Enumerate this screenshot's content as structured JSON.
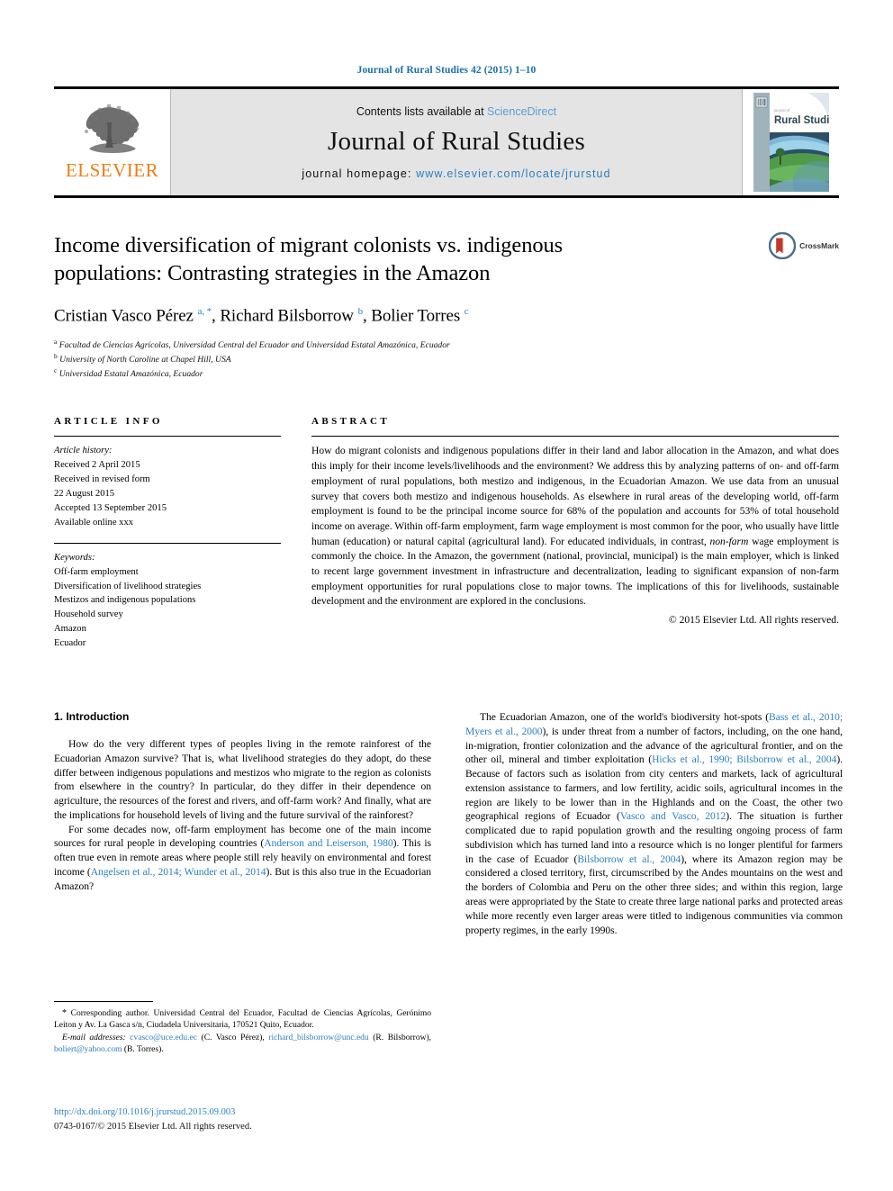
{
  "running_head": "Journal of Rural Studies 42 (2015) 1–10",
  "masthead": {
    "publisher_name": "ELSEVIER",
    "contents_prefix": "Contents lists available at",
    "contents_link": "ScienceDirect",
    "journal_name": "Journal of Rural Studies",
    "homepage_prefix": "journal homepage:",
    "homepage_url": "www.elsevier.com/locate/jrurstud",
    "cover_title": "Rural Studies",
    "cover_supertitle": "journal of"
  },
  "article": {
    "title": "Income diversification of migrant colonists vs. indigenous populations: Contrasting strategies in the Amazon",
    "authors_html": "Cristian Vasco Pérez <sup>a, *</sup>, Richard Bilsborrow <sup>b</sup>, Bolier Torres <sup>c</sup>",
    "affiliations": [
      {
        "marker": "a",
        "text": "Facultad de Ciencias Agrícolas, Universidad Central del Ecuador and Universidad Estatal Amazónica, Ecuador"
      },
      {
        "marker": "b",
        "text": "University of North Caroline at Chapel Hill, USA"
      },
      {
        "marker": "c",
        "text": "Universidad Estatal Amazónica, Ecuador"
      }
    ],
    "crossmark_label": "CrossMark"
  },
  "article_info": {
    "heading": "ARTICLE INFO",
    "history_label": "Article history:",
    "history": [
      "Received 2 April 2015",
      "Received in revised form",
      "22 August 2015",
      "Accepted 13 September 2015",
      "Available online xxx"
    ],
    "keywords_label": "Keywords:",
    "keywords": [
      "Off-farm employment",
      "Diversification of livelihood strategies",
      "Mestizos and indigenous populations",
      "Household survey",
      "Amazon",
      "Ecuador"
    ]
  },
  "abstract": {
    "heading": "ABSTRACT",
    "text_html": "How do migrant colonists and indigenous populations differ in their land and labor allocation in the Amazon, and what does this imply for their income levels/livelihoods and the environment? We address this by analyzing patterns of on- and off-farm employment of rural populations, both mestizo and indigenous, in the Ecuadorian Amazon. We use data from an unusual survey that covers both mestizo and indigenous households. As elsewhere in rural areas of the developing world, off-farm employment is found to be the principal income source for 68% of the population and accounts for 53% of total household income on average. Within off-farm employment, farm wage employment is most common for the poor, who usually have little human (education) or natural capital (agricultural land). For educated individuals, in contrast, <em>non-farm</em> wage employment is commonly the choice. In the Amazon, the government (national, provincial, municipal) is the main employer, which is linked to recent large government investment in infrastructure and decentralization, leading to significant expansion of non-farm employment opportunities for rural populations close to major towns. The implications of this for livelihoods, sustainable development and the environment are explored in the conclusions.",
    "copyright": "© 2015 Elsevier Ltd. All rights reserved."
  },
  "introduction": {
    "heading": "1. Introduction",
    "left_paragraphs_html": [
      "How do the very different types of peoples living in the remote rainforest of the Ecuadorian Amazon survive? That is, what livelihood strategies do they adopt, do these differ between indigenous populations and mestizos who migrate to the region as colonists from elsewhere in the country? In particular, do they differ in their dependence on agriculture, the resources of the forest and rivers, and off-farm work? And finally, what are the implications for household levels of living and the future survival of the rainforest?",
      "For some decades now, off-farm employment has become one of the main income sources for rural people in developing countries (<span class=\"ref\">Anderson and Leiserson, 1980</span>). This is often true even in remote areas where people still rely heavily on environmental and forest income (<span class=\"ref\">Angelsen et al., 2014; Wunder et al., 2014</span>). But is this also true in the Ecuadorian Amazon?"
    ],
    "right_paragraphs_html": [
      "The Ecuadorian Amazon, one of the world's biodiversity hot-spots (<span class=\"ref\">Bass et al., 2010; Myers et al., 2000</span>), is under threat from a number of factors, including, on the one hand, in-migration, frontier colonization and the advance of the agricultural frontier, and on the other oil, mineral and timber exploitation (<span class=\"ref\">Hicks et al., 1990; Bilsborrow et al., 2004</span>). Because of factors such as isolation from city centers and markets, lack of agricultural extension assistance to farmers, and low fertility, acidic soils, agricultural incomes in the region are likely to be lower than in the Highlands and on the Coast, the other two geographical regions of Ecuador (<span class=\"ref\">Vasco and Vasco, 2012</span>). The situation is further complicated due to rapid population growth and the resulting ongoing process of farm subdivision which has turned land into a resource which is no longer plentiful for farmers in the case of Ecuador (<span class=\"ref\">Bilsborrow et al., 2004</span>), where its Amazon region may be considered a closed territory, first, circumscribed by the Andes mountains on the west and the borders of Colombia and Peru on the other three sides; and within this region, large areas were appropriated by the State to create three large national parks and protected areas while more recently even larger areas were titled to indigenous communities via common property regimes, in the early 1990s."
    ]
  },
  "footnotes": {
    "corresponding_html": "<span class=\"star\">*</span> Corresponding author. Universidad Central del Ecuador, Facultad de Ciencias Agrícolas, Gerónimo Leiton y Av. La Gasca s/n, Ciudadela Universitaria, 170521 Quito, Ecuador.",
    "emails_html": "<em>E-mail addresses:</em> <span class=\"lnk\">cvasco@uce.edu.ec</span> (C. Vasco Pérez), <span class=\"lnk\">richard_bilsborrow@unc.edu</span> (R. Bilsborrow), <span class=\"lnk\">boliert@yahoo.com</span> (B. Torres).",
    "doi": "http://dx.doi.org/10.1016/j.jrurstud.2015.09.003",
    "issn_line": "0743-0167/© 2015 Elsevier Ltd. All rights reserved."
  },
  "colors": {
    "link_blue": "#2b7fc0",
    "elsevier_orange": "#f07d12",
    "masthead_grey": "#e4e4e4"
  }
}
